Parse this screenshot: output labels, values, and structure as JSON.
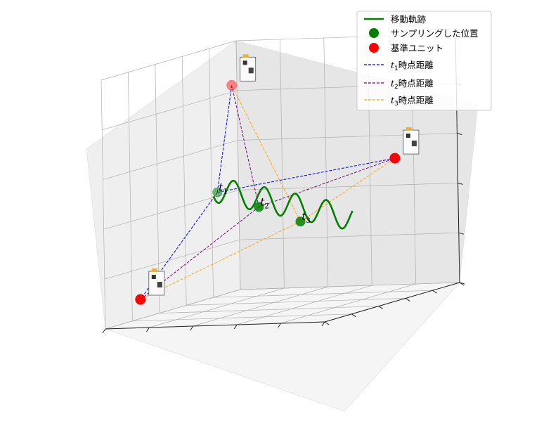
{
  "chart_data": {
    "type": "3d-line-scatter",
    "title": "",
    "xlabel": "",
    "ylabel": "",
    "zlabel": "",
    "grid": true,
    "tick_labels_visible": false,
    "legend": {
      "position": "top-right",
      "entries": [
        {
          "label": "移動軌跡",
          "kind": "line",
          "color": "#008000"
        },
        {
          "label": "サンプリングした位置",
          "kind": "marker",
          "color": "#008000"
        },
        {
          "label": "基準ユニット",
          "kind": "marker",
          "color": "#ff0000"
        },
        {
          "label_italic": "t",
          "label_sub": "1",
          "label_rest": "時点距離",
          "kind": "dashed",
          "color": "#0000ff"
        },
        {
          "label_italic": "t",
          "label_sub": "2",
          "label_rest": "時点距離",
          "kind": "dashed",
          "color": "#800080"
        },
        {
          "label_italic": "t",
          "label_sub": "3",
          "label_rest": "時点距離",
          "kind": "dashed",
          "color": "#ffa500"
        }
      ]
    },
    "reference_units": [
      {
        "name": "unit-back",
        "x": 1.0,
        "y": 8.0,
        "z": 8.5
      },
      {
        "name": "unit-right",
        "x": 9.0,
        "y": 7.0,
        "z": 5.5
      },
      {
        "name": "unit-front",
        "x": 1.0,
        "y": 1.0,
        "z": 1.0
      }
    ],
    "sampling_points": [
      {
        "label_italic": "t",
        "label_sub": "1",
        "x": 1.5,
        "y": 6.0,
        "z": 4.5
      },
      {
        "label_italic": "t",
        "label_sub": "2",
        "x": 4.0,
        "y": 5.0,
        "z": 4.0
      },
      {
        "label_italic": "t",
        "label_sub": "3",
        "x": 6.5,
        "y": 4.0,
        "z": 3.5
      }
    ],
    "trajectory": {
      "name": "移動軌跡",
      "color": "#008000",
      "x_range": [
        1.2,
        9.0
      ],
      "wave_amplitude": 1.0,
      "wave_cycles": 4.5
    },
    "distance_colors": {
      "t1": "#0000ff",
      "t2": "#800080",
      "t3": "#ffa500"
    },
    "colors": {
      "trajectory": "#008000",
      "sampling": "#008000",
      "reference": "#ff0000",
      "pane": "#f2f2f2",
      "grid": "#b0b0b0"
    }
  }
}
